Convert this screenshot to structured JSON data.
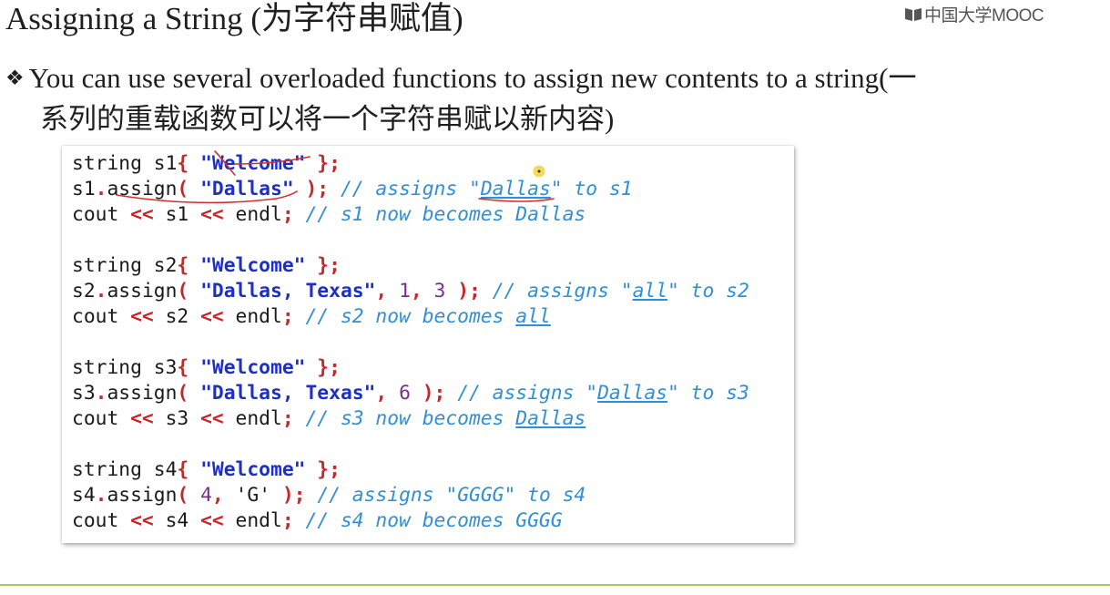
{
  "slide": {
    "title": "Assigning a String (为字符串赋值)",
    "logo_text": "中国大学MOOC",
    "logo_icon": "book-icon",
    "bullet_marker": "❖",
    "bullet_line1": "You can use several overloaded functions to assign new contents to a string(一",
    "bullet_line2": "系列的重载函数可以将一个字符串赋以新内容)"
  },
  "code": {
    "l1": {
      "a": "string s1",
      "p1": "{",
      "s1": "\"Welcome\"",
      "p2": "};"
    },
    "l2": {
      "a": "s1",
      "p1": ".",
      "b": "assign",
      "p2": "(",
      "s1": "\"Dallas\"",
      "p3": ");",
      "c1": "// assigns \"",
      "cu": "Dallas",
      "c2": "\" to s1"
    },
    "l3": {
      "a": "cout ",
      "p1": "<<",
      "b": " s1 ",
      "p2": "<<",
      "d": " endl",
      "p3": ";",
      "c1": "// s1 now becomes Dallas"
    },
    "l5": {
      "a": "string s2",
      "p1": "{",
      "s1": "\"Welcome\"",
      "p2": "};"
    },
    "l6": {
      "a": "s2",
      "p1": ".",
      "b": "assign",
      "p2": "(",
      "s1": "\"Dallas, Texas\"",
      "p3": ",",
      "n1": "1",
      "p4": ",",
      "n2": "3",
      "p5": ");",
      "c1": "// assigns \"",
      "cu": "all",
      "c2": "\" to s2"
    },
    "l7": {
      "a": "cout ",
      "p1": "<<",
      "b": " s2 ",
      "p2": "<<",
      "d": " endl",
      "p3": ";",
      "c1": "// s2 now becomes ",
      "cu": "all"
    },
    "l9": {
      "a": "string s3",
      "p1": "{",
      "s1": "\"Welcome\"",
      "p2": "};"
    },
    "l10": {
      "a": "s3",
      "p1": ".",
      "b": "assign",
      "p2": "(",
      "s1": "\"Dallas, Texas\"",
      "p3": ",",
      "n1": "6",
      "p4": ");",
      "c1": "// assigns \"",
      "cu": "Dallas",
      "c2": "\" to s3"
    },
    "l11": {
      "a": "cout ",
      "p1": "<<",
      "b": " s3 ",
      "p2": "<<",
      "d": " endl",
      "p3": ";",
      "c1": "// s3 now becomes ",
      "cu": "Dallas"
    },
    "l13": {
      "a": "string s4",
      "p1": "{",
      "s1": "\"Welcome\"",
      "p2": "};"
    },
    "l14": {
      "a": "s4",
      "p1": ".",
      "b": "assign",
      "p2": "(",
      "n1": "4",
      "p3": ",",
      "s1": "'G'",
      "p4": ");",
      "c1": "// assigns \"GGGG\" to s4"
    },
    "l15": {
      "a": "cout ",
      "p1": "<<",
      "b": " s4 ",
      "p2": "<<",
      "d": " endl",
      "p3": ";",
      "c1": "// s4 now becomes GGGG"
    }
  },
  "colors": {
    "punctuation": "#c62828",
    "string_literal": "#1d2fc4",
    "number": "#7b2d8e",
    "comment": "#2f8fd8",
    "ink_annotation": "#d32f2f",
    "footer_rule": "#a8c86e"
  }
}
